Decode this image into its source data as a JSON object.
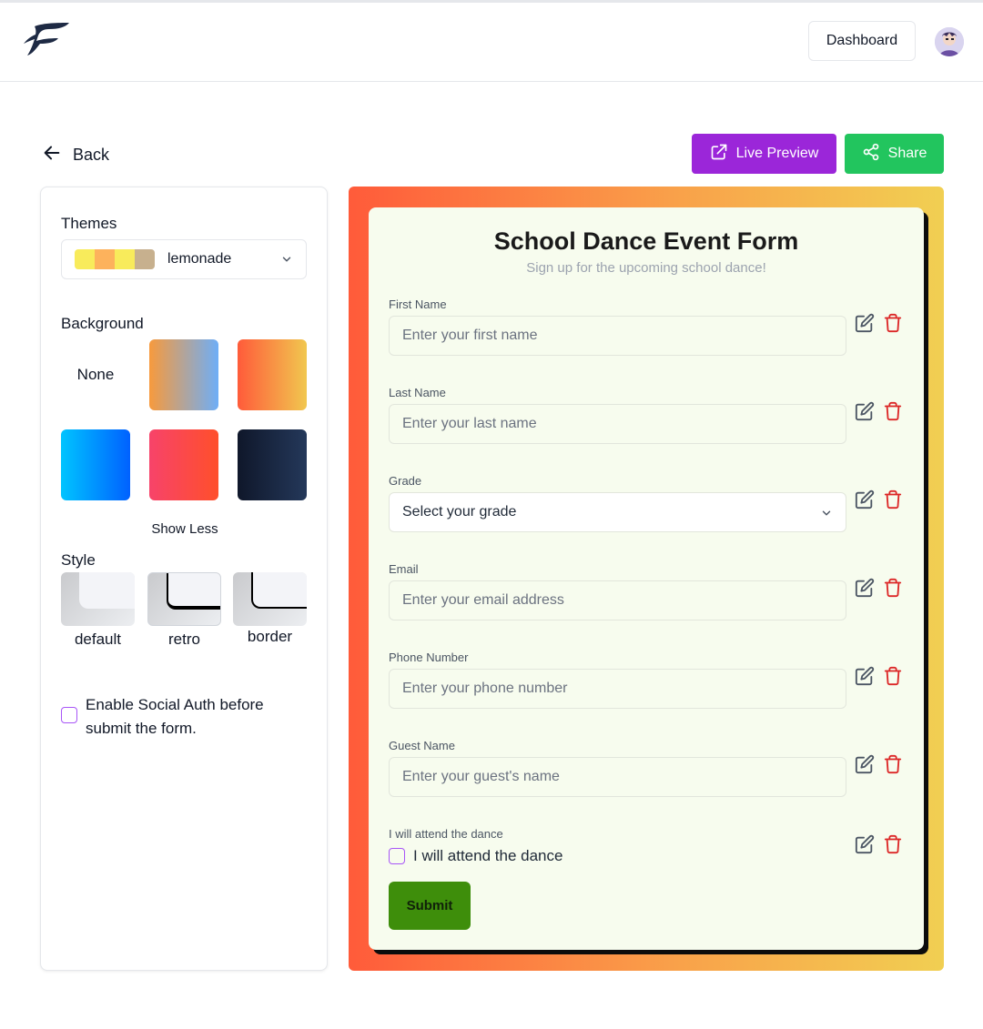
{
  "header": {
    "dashboard_label": "Dashboard"
  },
  "toolbar": {
    "back_label": "Back",
    "live_preview_label": "Live Preview",
    "share_label": "Share"
  },
  "sidebar": {
    "themes_label": "Themes",
    "theme_value": "lemonade",
    "theme_swatches": [
      "#f8eb5b",
      "#fdb25c",
      "#f8eb5b",
      "#c7b08e"
    ],
    "background_label": "Background",
    "background_none": "None",
    "backgrounds": [
      "linear-gradient(90deg,#f79a3d,#6eaef7)",
      "linear-gradient(90deg,#ff5b3a,#f1c74f)",
      "linear-gradient(90deg,#00c4ff,#0061ff)",
      "linear-gradient(90deg,#f7436a,#ff4f2b)",
      "linear-gradient(90deg,#0f172a,#24385a)"
    ],
    "show_less_label": "Show Less",
    "style_label": "Style",
    "styles": [
      "default",
      "retro",
      "border"
    ],
    "social_auth_label": "Enable Social Auth before submit the form."
  },
  "form": {
    "title": "School Dance Event Form",
    "subtitle": "Sign up for the upcoming school dance!",
    "fields": [
      {
        "label": "First Name",
        "placeholder": "Enter your first name"
      },
      {
        "label": "Last Name",
        "placeholder": "Enter your last name"
      },
      {
        "label": "Grade",
        "placeholder": "Select your grade"
      },
      {
        "label": "Email",
        "placeholder": "Enter your email address"
      },
      {
        "label": "Phone Number",
        "placeholder": "Enter your phone number"
      },
      {
        "label": "Guest Name",
        "placeholder": "Enter your guest's name"
      }
    ],
    "checkbox_field_label": "I will attend the dance",
    "checkbox_text": "I will attend the dance",
    "submit_label": "Submit"
  },
  "colors": {
    "accent_purple": "#9b26d9",
    "share_green": "#22c55e",
    "submit_green": "#3e8e0b",
    "card_bg": "#f7fcee",
    "delete_red": "#dc2626"
  }
}
